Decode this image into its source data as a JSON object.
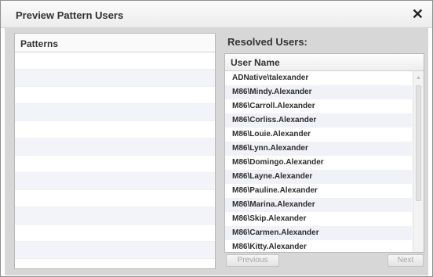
{
  "dialog": {
    "title": "Preview Pattern Users",
    "close_glyph": "✕"
  },
  "patterns": {
    "header": "Patterns"
  },
  "resolved": {
    "title": "Resolved Users:",
    "column_header": "User Name",
    "users": [
      "ADNative\\talexander",
      "M86\\Mindy.Alexander",
      "M86\\Carroll.Alexander",
      "M86\\Corliss.Alexander",
      "M86\\Louie.Alexander",
      "M86\\Lynn.Alexander",
      "M86\\Domingo.Alexander",
      "M86\\Layne.Alexander",
      "M86\\Pauline.Alexander",
      "M86\\Marina.Alexander",
      "M86\\Skip.Alexander",
      "M86\\Carmen.Alexander",
      "M86\\Kitty.Alexander"
    ]
  },
  "pagination": {
    "previous_label": "Previous",
    "next_label": "Next"
  }
}
